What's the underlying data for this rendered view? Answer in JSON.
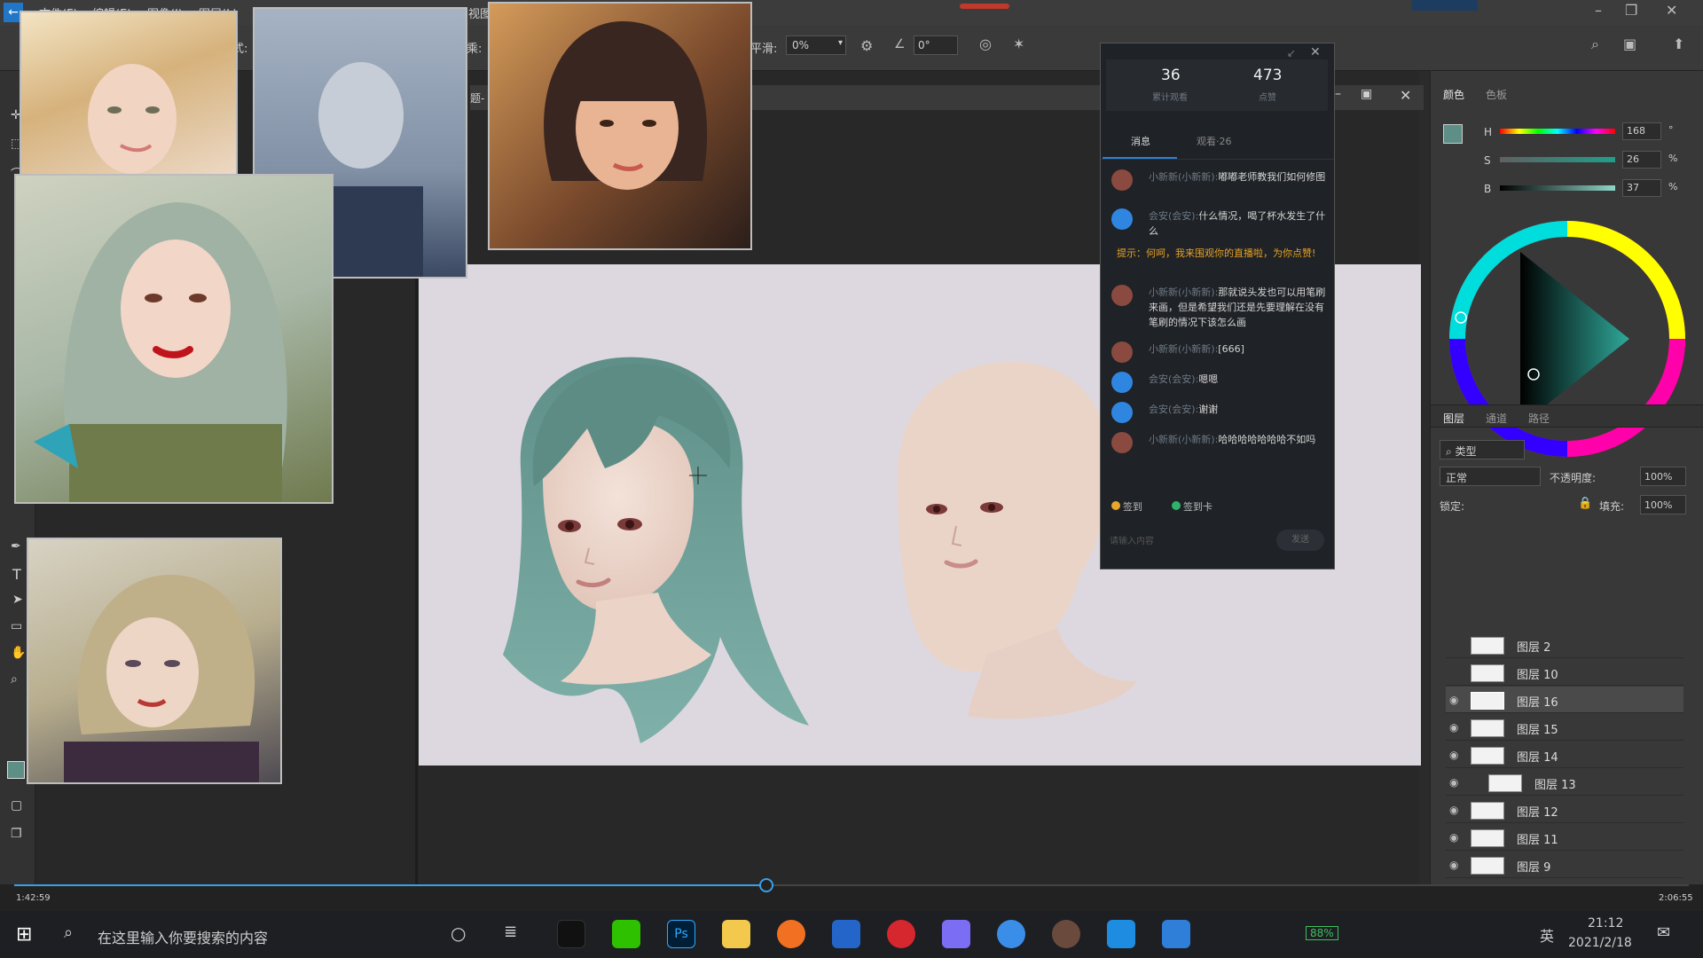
{
  "menu": {
    "file": "文件(F)",
    "edit": "编辑(E)",
    "image": "图像(I)",
    "layer": "图层(L)",
    "view": "视图"
  },
  "options": {
    "smoothing_label": "平滑:",
    "smoothing_value": "0%",
    "angle_value": "0°",
    "partial1": "式:",
    "partial2": "乘:"
  },
  "doc_title_partial": "题-",
  "chat": {
    "watch_count": "36",
    "watch_label": "累计观看",
    "like_count": "473",
    "like_label": "点赞",
    "tab_messages": "消息",
    "tab_viewers": "观看·26",
    "messages": [
      {
        "name": "小新新(小新新):",
        "text": "嘟嘟老师教我们如何修图"
      },
      {
        "name": "会安(会安):",
        "text": "什么情况，喝了杯水发生了什么"
      },
      {
        "name": "",
        "text": "提示：何呵，我来围观你的直播啦，为你点赞!"
      },
      {
        "name": "小新新(小新新):",
        "text": "那就说头发也可以用笔刷来画，但是希望我们还是先要理解在没有笔刷的情况下该怎么画"
      },
      {
        "name": "小新新(小新新):",
        "text": "[666]"
      },
      {
        "name": "会安(会安):",
        "text": "嗯嗯"
      },
      {
        "name": "会安(会安):",
        "text": "谢谢"
      },
      {
        "name": "小新新(小新新):",
        "text": "哈哈哈哈哈哈哈不如吗"
      }
    ],
    "signin": "签到",
    "gift": "签到卡",
    "input_placeholder": "请输入内容",
    "send": "发送"
  },
  "color_panel": {
    "tab_color": "颜色",
    "tab_swatches": "色板",
    "h_label": "H",
    "h_value": "168",
    "h_unit": "°",
    "s_label": "S",
    "s_value": "26",
    "s_unit": "%",
    "b_label": "B",
    "b_value": "37",
    "b_unit": "%"
  },
  "layers_panel": {
    "tab_layers": "图层",
    "tab_channels": "通道",
    "tab_paths": "路径",
    "kind_label": "类型",
    "blend_mode": "正常",
    "opacity_label": "不透明度:",
    "opacity_value": "100%",
    "lock_label": "锁定:",
    "fill_label": "填充:",
    "fill_value": "100%",
    "layers": [
      "图层 2",
      "图层 10",
      "图层 16",
      "图层 15",
      "图层 14",
      "图层 13",
      "图层 12",
      "图层 11",
      "图层 9"
    ]
  },
  "timeline": {
    "current": "1:42:59",
    "total": "2:06:55",
    "progress": 0.449
  },
  "taskbar": {
    "search_placeholder": "在这里输入你要搜索的内容",
    "battery": "88%",
    "ime": "英",
    "time": "21:12",
    "date": "2021/2/18"
  },
  "colors": {
    "hair": "#6f9e98",
    "skin": "#ecd5c8",
    "canvas": "#ddd8df",
    "accent_blue": "#3aa0e6",
    "warning": "#e5a128"
  }
}
